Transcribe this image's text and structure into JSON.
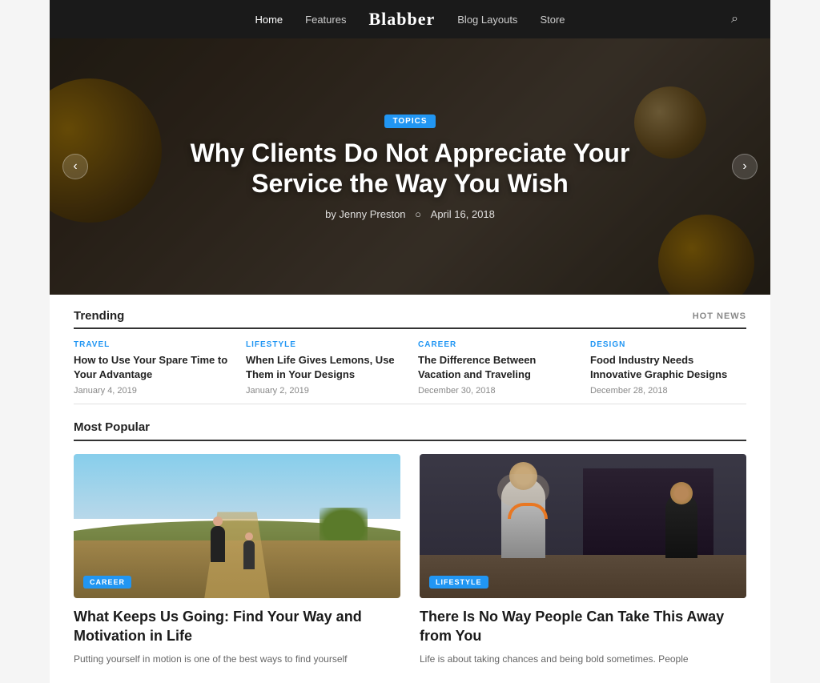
{
  "nav": {
    "links": [
      {
        "label": "Home",
        "active": true
      },
      {
        "label": "Features",
        "active": false
      },
      {
        "label": "Blog Layouts",
        "active": false
      },
      {
        "label": "Store",
        "active": false
      }
    ],
    "logo": "Blabber",
    "search_icon": "🔍"
  },
  "hero": {
    "badge": "TOPICS",
    "title": "Why Clients Do Not Appreciate Your Service the Way You Wish",
    "author": "by Jenny Preston",
    "date": "April 16, 2018",
    "prev_label": "‹",
    "next_label": "›"
  },
  "trending": {
    "section_title": "Trending",
    "hot_news_label": "HOT NEWS",
    "items": [
      {
        "category": "TRAVEL",
        "title": "How to Use Your Spare Time to Your Advantage",
        "date": "January 4, 2019"
      },
      {
        "category": "LIFESTYLE",
        "title": "When Life Gives Lemons, Use Them in Your Designs",
        "date": "January 2, 2019"
      },
      {
        "category": "CAREER",
        "title": "The Difference Between Vacation and Traveling",
        "date": "December 30, 2018"
      },
      {
        "category": "DESIGN",
        "title": "Food Industry Needs Innovative Graphic Designs",
        "date": "December 28, 2018"
      }
    ]
  },
  "popular": {
    "section_title": "Most Popular",
    "cards": [
      {
        "badge": "CAREER",
        "title": "What Keeps Us Going: Find Your Way and Motivation in Life",
        "excerpt": "Putting yourself in motion is one of the best ways to find yourself",
        "image_type": "running"
      },
      {
        "badge": "LIFESTYLE",
        "title": "There Is No Way People Can Take This Away from You",
        "excerpt": "Life is about taking chances and being bold sometimes. People",
        "image_type": "studio"
      }
    ]
  }
}
